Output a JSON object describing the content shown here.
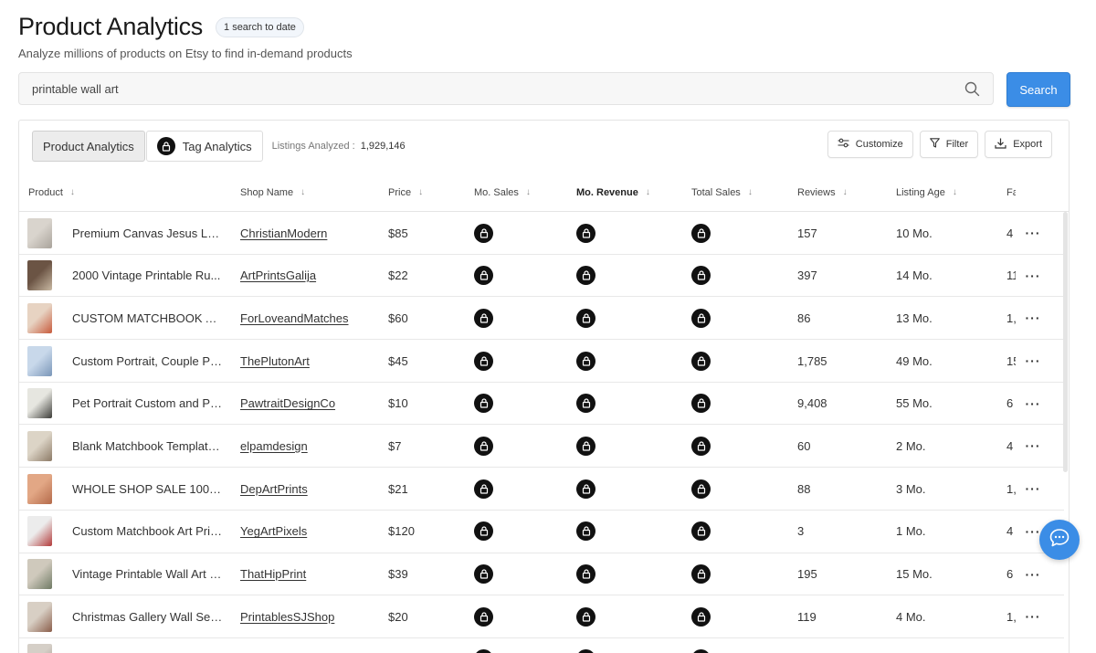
{
  "header": {
    "title": "Product Analytics",
    "badge": "1 search to date",
    "subtitle": "Analyze millions of products on Etsy to find in-demand products"
  },
  "search": {
    "value": "printable wall art",
    "button_label": "Search"
  },
  "toolbar": {
    "tabs": [
      {
        "label": "Product Analytics",
        "active": true,
        "locked": false
      },
      {
        "label": "Tag Analytics",
        "active": false,
        "locked": true
      }
    ],
    "listings_label": "Listings Analyzed :",
    "listings_value": "1,929,146",
    "customize_label": "Customize",
    "filter_label": "Filter",
    "export_label": "Export"
  },
  "columns": [
    "Product",
    "Shop Name",
    "Price",
    "Mo. Sales",
    "Mo. Revenue",
    "Total Sales",
    "Reviews",
    "Listing Age",
    "Fa"
  ],
  "rows": [
    {
      "product": "Premium Canvas Jesus Lea...",
      "shop": "ChristianModern",
      "price": "$85",
      "reviews": "157",
      "age": "10 Mo.",
      "fav": "4",
      "thumb": [
        "#d9d4cd",
        "#a9a39b"
      ]
    },
    {
      "product": "2000 Vintage Printable Ru...",
      "shop": "ArtPrintsGalija",
      "price": "$22",
      "reviews": "397",
      "age": "14 Mo.",
      "fav": "11",
      "thumb": [
        "#6b5444",
        "#c9b9a3"
      ]
    },
    {
      "product": "CUSTOM MATCHBOOK AR...",
      "shop": "ForLoveandMatches",
      "price": "$60",
      "reviews": "86",
      "age": "13 Mo.",
      "fav": "1,",
      "thumb": [
        "#e7d3c2",
        "#c75a3c"
      ]
    },
    {
      "product": "Custom Portrait, Couple Po...",
      "shop": "ThePlutonArt",
      "price": "$45",
      "reviews": "1,785",
      "age": "49 Mo.",
      "fav": "15",
      "thumb": [
        "#c8d8ea",
        "#7a96b8"
      ]
    },
    {
      "product": "Pet Portrait Custom and Pe...",
      "shop": "PawtraitDesignCo",
      "price": "$10",
      "reviews": "9,408",
      "age": "55 Mo.",
      "fav": "6",
      "thumb": [
        "#e6e6e0",
        "#3c3c38"
      ]
    },
    {
      "product": "Blank Matchbook Template,...",
      "shop": "elpamdesign",
      "price": "$7",
      "reviews": "60",
      "age": "2 Mo.",
      "fav": "4",
      "thumb": [
        "#dcd4c6",
        "#8c7a66"
      ]
    },
    {
      "product": "WHOLE SHOP SALE 1000...",
      "shop": "DepArtPrints",
      "price": "$21",
      "reviews": "88",
      "age": "3 Mo.",
      "fav": "1,",
      "thumb": [
        "#e2a785",
        "#b46a4a"
      ]
    },
    {
      "product": "Custom Matchbook Art Prin...",
      "shop": "YegArtPixels",
      "price": "$120",
      "reviews": "3",
      "age": "1 Mo.",
      "fav": "4",
      "thumb": [
        "#ececec",
        "#b23a3a"
      ]
    },
    {
      "product": "Vintage Printable Wall Art B...",
      "shop": "ThatHipPrint",
      "price": "$39",
      "reviews": "195",
      "age": "15 Mo.",
      "fav": "6",
      "thumb": [
        "#cfc9bc",
        "#6f7a64"
      ]
    },
    {
      "product": "Christmas Gallery Wall Set ...",
      "shop": "PrintablesSJShop",
      "price": "$20",
      "reviews": "119",
      "age": "4 Mo.",
      "fav": "1,",
      "thumb": [
        "#d8cfc4",
        "#8a5d4a"
      ]
    },
    {
      "product": "",
      "shop": "",
      "price": "",
      "reviews": "",
      "age": "",
      "fav": "",
      "thumb": [
        "#d5cfc7",
        "#9a8f84"
      ]
    }
  ],
  "colors": {
    "accent": "#3b8de6",
    "lock": "#111111",
    "border": "#e4e4e4"
  },
  "icons": {
    "search": "search-icon",
    "lock": "lock-icon",
    "customize": "sliders-icon",
    "filter": "filter-icon",
    "export": "download-icon",
    "sort": "arrow-down-icon",
    "more": "more-dots-icon",
    "chat": "chat-icon"
  }
}
